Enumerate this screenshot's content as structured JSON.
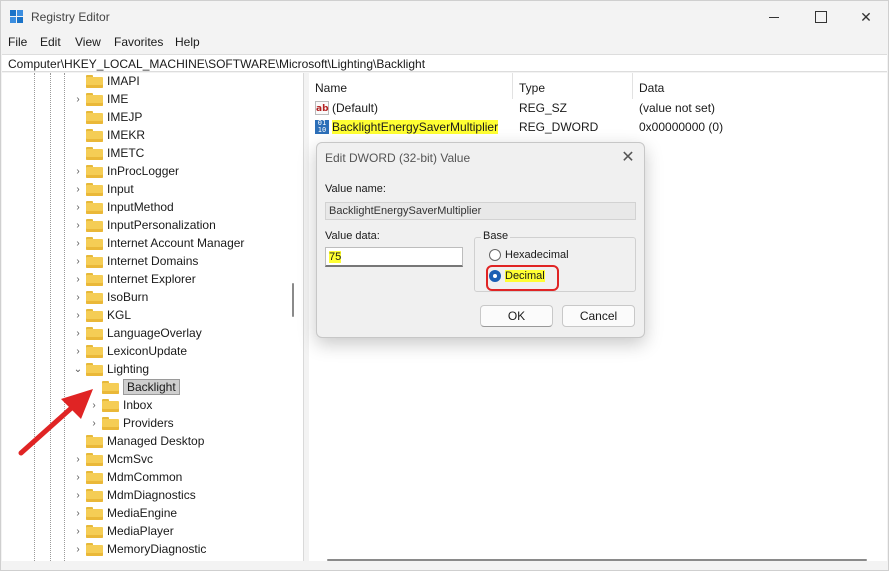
{
  "window": {
    "title": "Registry Editor",
    "icons": {
      "app": "registry-editor-icon",
      "minimize": "minimize-icon",
      "maximize": "maximize-icon",
      "close": "close-icon"
    }
  },
  "menu": [
    "File",
    "Edit",
    "View",
    "Favorites",
    "Help"
  ],
  "address": "Computer\\HKEY_LOCAL_MACHINE\\SOFTWARE\\Microsoft\\Lighting\\Backlight",
  "tree": {
    "items": [
      {
        "label": "IMAPI",
        "expander": "none"
      },
      {
        "label": "IME",
        "expander": "collapsed"
      },
      {
        "label": "IMEJP",
        "expander": "none"
      },
      {
        "label": "IMEKR",
        "expander": "none"
      },
      {
        "label": "IMETC",
        "expander": "none"
      },
      {
        "label": "InProcLogger",
        "expander": "collapsed"
      },
      {
        "label": "Input",
        "expander": "collapsed"
      },
      {
        "label": "InputMethod",
        "expander": "collapsed"
      },
      {
        "label": "InputPersonalization",
        "expander": "collapsed"
      },
      {
        "label": "Internet Account Manager",
        "expander": "collapsed"
      },
      {
        "label": "Internet Domains",
        "expander": "collapsed"
      },
      {
        "label": "Internet Explorer",
        "expander": "collapsed"
      },
      {
        "label": "IsoBurn",
        "expander": "collapsed"
      },
      {
        "label": "KGL",
        "expander": "collapsed"
      },
      {
        "label": "LanguageOverlay",
        "expander": "collapsed"
      },
      {
        "label": "LexiconUpdate",
        "expander": "collapsed"
      },
      {
        "label": "Lighting",
        "expander": "expanded"
      },
      {
        "label": "Backlight",
        "expander": "none",
        "selected": true
      },
      {
        "label": "Inbox",
        "expander": "collapsed"
      },
      {
        "label": "Providers",
        "expander": "collapsed"
      },
      {
        "label": "Managed Desktop",
        "expander": "none"
      },
      {
        "label": "McmSvc",
        "expander": "collapsed"
      },
      {
        "label": "MdmCommon",
        "expander": "collapsed"
      },
      {
        "label": "MdmDiagnostics",
        "expander": "collapsed"
      },
      {
        "label": "MediaEngine",
        "expander": "collapsed"
      },
      {
        "label": "MediaPlayer",
        "expander": "collapsed"
      },
      {
        "label": "MemoryDiagnostic",
        "expander": "collapsed"
      }
    ]
  },
  "list": {
    "columns": [
      "Name",
      "Type",
      "Data"
    ],
    "rows": [
      {
        "name": "(Default)",
        "type": "REG_SZ",
        "data": "(value not set)",
        "icon": "string-value-icon"
      },
      {
        "name": "BacklightEnergySaverMultiplier",
        "type": "REG_DWORD",
        "data": "0x00000000 (0)",
        "icon": "dword-value-icon",
        "highlighted": true
      }
    ]
  },
  "dialog": {
    "title": "Edit DWORD (32-bit) Value",
    "value_name_label": "Value name:",
    "value_name": "BacklightEnergySaverMultiplier",
    "value_data_label": "Value data:",
    "value_data": "75",
    "base_label": "Base",
    "hex_label": "Hexadecimal",
    "decimal_label": "Decimal",
    "selected_base": "Decimal",
    "ok": "OK",
    "cancel": "Cancel"
  },
  "colors": {
    "highlight": "#ffff33",
    "annotation": "#e02424",
    "folder": "#f5cd55"
  }
}
